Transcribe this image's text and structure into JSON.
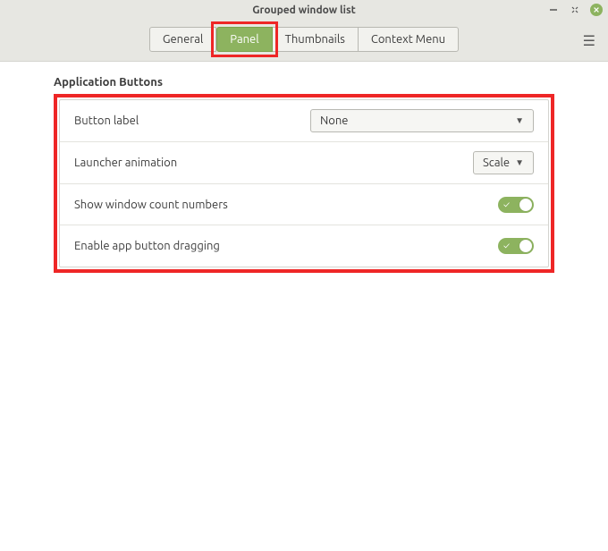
{
  "window": {
    "title": "Grouped window list"
  },
  "tabs": [
    {
      "label": "General",
      "active": false
    },
    {
      "label": "Panel",
      "active": true
    },
    {
      "label": "Thumbnails",
      "active": false
    },
    {
      "label": "Context Menu",
      "active": false
    }
  ],
  "section": {
    "title": "Application Buttons",
    "rows": {
      "button_label": {
        "label": "Button label",
        "value": "None"
      },
      "launcher_animation": {
        "label": "Launcher animation",
        "value": "Scale"
      },
      "show_count": {
        "label": "Show window count numbers",
        "enabled": true
      },
      "enable_drag": {
        "label": "Enable app button dragging",
        "enabled": true
      }
    }
  }
}
